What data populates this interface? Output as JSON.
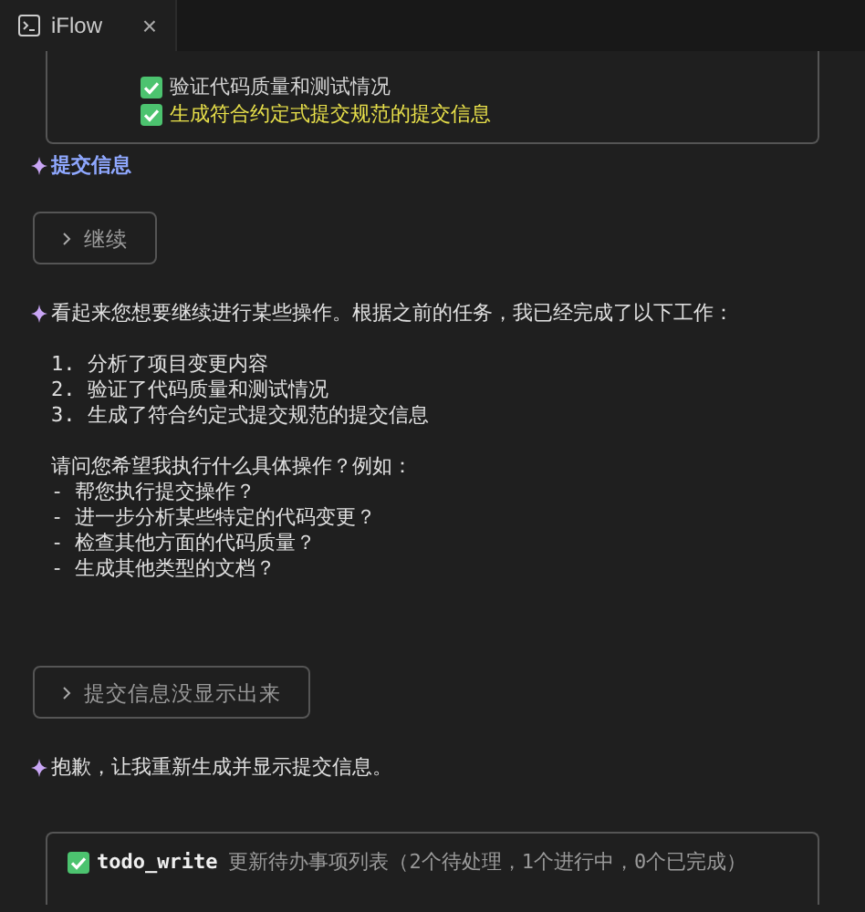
{
  "tab": {
    "title": "iFlow",
    "close": "×"
  },
  "blocks": [
    {
      "kind": "checklist",
      "items": [
        {
          "text": "验证代码质量和测试情况",
          "checked": true,
          "highlighted": false
        },
        {
          "text": "生成符合约定式提交规范的提交信息",
          "checked": true,
          "highlighted": true
        }
      ]
    },
    {
      "kind": "heading",
      "text": "提交信息"
    },
    {
      "kind": "prompt",
      "text": "继续"
    },
    {
      "kind": "message",
      "paragraphs": [
        [
          "看起来您想要继续进行某些操作。根据之前的任务，我已经完成了以下工作："
        ],
        [
          "1. 分析了项目变更内容",
          "2. 验证了代码质量和测试情况",
          "3. 生成了符合约定式提交规范的提交信息"
        ],
        [
          "请问您希望我执行什么具体操作？例如：",
          "- 帮您执行提交操作？",
          "- 进一步分析某些特定的代码变更？",
          "- 检查其他方面的代码质量？",
          "- 生成其他类型的文档？"
        ]
      ]
    },
    {
      "kind": "prompt",
      "text": "提交信息没显示出来"
    },
    {
      "kind": "message",
      "paragraphs": [
        [
          "抱歉，让我重新生成并显示提交信息。"
        ]
      ]
    },
    {
      "kind": "tool_call",
      "name": "todo_write",
      "description": "更新待办事项列表（2个待处理，1个进行中，0个已完成）"
    }
  ]
}
